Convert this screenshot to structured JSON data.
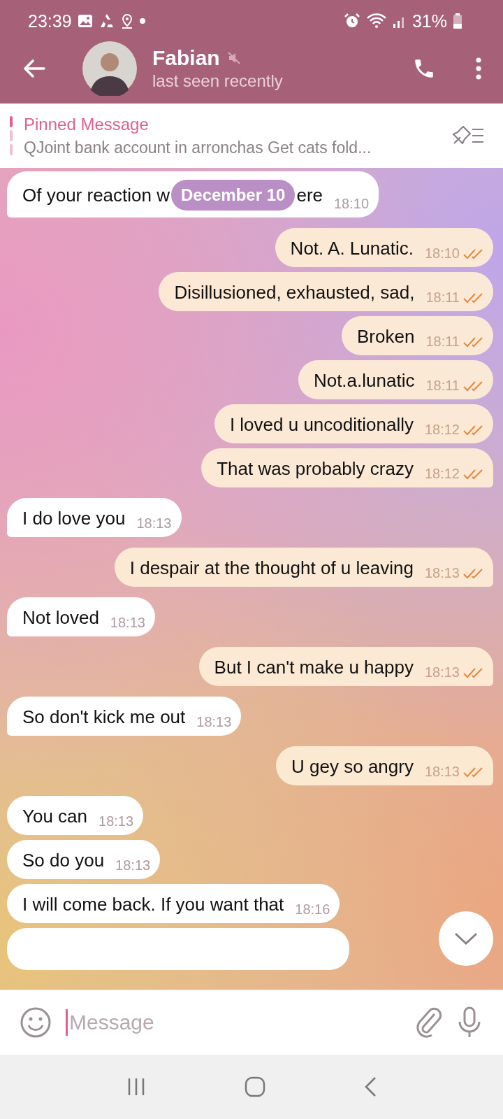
{
  "status_bar": {
    "time": "23:39",
    "battery": "31%"
  },
  "header": {
    "name": "Fabian",
    "muted": true,
    "status": "last seen recently"
  },
  "pinned": {
    "title": "Pinned Message",
    "text": "QJoint bank account in arronchas  Get cats fold..."
  },
  "messages": [
    {
      "kind": "incoming",
      "text_parts": [
        "Of your reaction w",
        "ere"
      ],
      "date_badge": "December 10",
      "time": "18:10"
    },
    {
      "kind": "outgoing",
      "text": "Not. A. Lunatic.",
      "time": "18:10",
      "read": true
    },
    {
      "kind": "outgoing",
      "text": "Disillusioned,  exhausted, sad,",
      "time": "18:11",
      "read": true
    },
    {
      "kind": "outgoing",
      "text": "Broken",
      "time": "18:11",
      "read": true
    },
    {
      "kind": "outgoing",
      "text": "Not.a.lunatic",
      "time": "18:11",
      "read": true
    },
    {
      "kind": "outgoing",
      "text": "I loved u uncoditionally",
      "time": "18:12",
      "read": true
    },
    {
      "kind": "outgoing",
      "text": "That was probably crazy",
      "time": "18:12",
      "read": true
    },
    {
      "kind": "incoming",
      "text": "I do love you",
      "time": "18:13"
    },
    {
      "kind": "outgoing",
      "text": "I despair at the thought of u leaving",
      "time": "18:13",
      "read": true
    },
    {
      "kind": "incoming",
      "text": "Not loved",
      "time": "18:13"
    },
    {
      "kind": "outgoing",
      "text": "But I can't make u happy",
      "time": "18:13",
      "read": true
    },
    {
      "kind": "incoming",
      "text": "So don't kick me out",
      "time": "18:13"
    },
    {
      "kind": "outgoing",
      "text": "U gey so angry",
      "time": "18:13",
      "read": true
    },
    {
      "kind": "incoming",
      "text": "You can",
      "time": "18:13"
    },
    {
      "kind": "incoming",
      "text": "So do you",
      "time": "18:13"
    },
    {
      "kind": "incoming",
      "text": "I will come back. If you want that",
      "time": "18:16"
    },
    {
      "kind": "partial"
    }
  ],
  "composer": {
    "placeholder": "Message"
  }
}
